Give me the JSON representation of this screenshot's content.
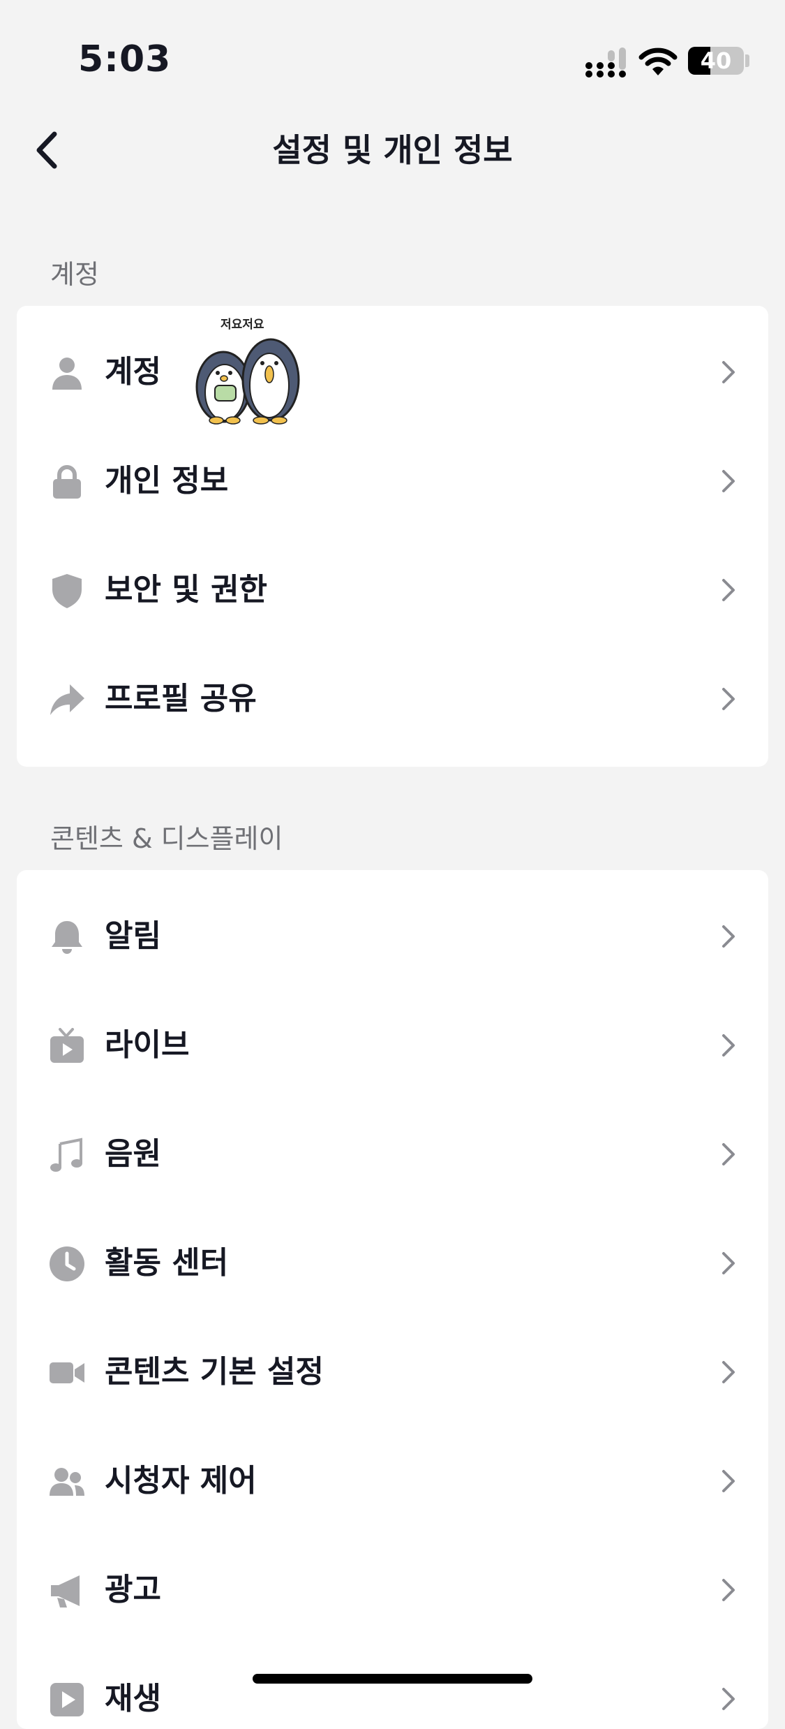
{
  "status_bar": {
    "time": "5:03",
    "battery_level": "40",
    "battery_fraction": 0.4
  },
  "header": {
    "title": "설정 및 개인 정보"
  },
  "sections": [
    {
      "label": "계정",
      "items": [
        {
          "label": "계정",
          "icon": "person-icon"
        },
        {
          "label": "개인 정보",
          "icon": "lock-icon"
        },
        {
          "label": "보안 및 권한",
          "icon": "shield-icon"
        },
        {
          "label": "프로필 공유",
          "icon": "share-arrow-icon"
        }
      ]
    },
    {
      "label": "콘텐츠 & 디스플레이",
      "items": [
        {
          "label": "알림",
          "icon": "bell-icon"
        },
        {
          "label": "라이브",
          "icon": "tv-icon"
        },
        {
          "label": "음원",
          "icon": "music-note-icon"
        },
        {
          "label": "활동 센터",
          "icon": "clock-icon"
        },
        {
          "label": "콘텐츠 기본 설정",
          "icon": "video-camera-icon"
        },
        {
          "label": "시청자 제어",
          "icon": "people-icon"
        },
        {
          "label": "광고",
          "icon": "megaphone-icon"
        },
        {
          "label": "재생",
          "icon": "play-icon"
        }
      ]
    }
  ],
  "sticker": {
    "text": "저요저요",
    "icon": "penguin-sticker"
  },
  "colors": {
    "background": "#f3f3f3",
    "card": "#ffffff",
    "icon_gray": "#a8a8ab",
    "text": "#161823",
    "section_label": "#6f7075"
  }
}
